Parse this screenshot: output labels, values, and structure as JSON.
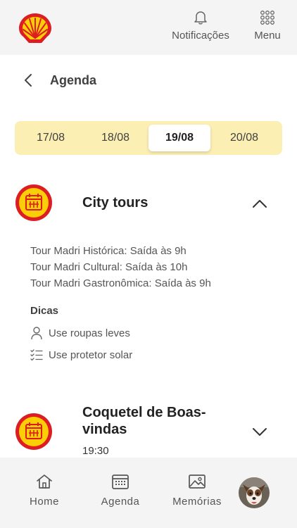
{
  "header": {
    "logo_icon": "shell-logo-icon",
    "notifications_label": "Notificações",
    "menu_label": "Menu"
  },
  "page": {
    "title": "Agenda"
  },
  "dates": {
    "items": [
      "17/08",
      "18/08",
      "19/08",
      "20/08"
    ],
    "selected": "19/08"
  },
  "events": [
    {
      "title": "City tours",
      "expanded": true,
      "details": [
        "Tour Madri Histórica: Saída às 9h",
        "Tour Madri Cultural: Saída às 10h",
        "Tour Madri Gastronômica: Saída às 9h"
      ],
      "tips_title": "Dicas",
      "tips": [
        {
          "icon": "person-icon",
          "text": "Use roupas leves"
        },
        {
          "icon": "checklist-icon",
          "text": "Use protetor solar"
        }
      ]
    },
    {
      "title_line1": "Coquetel de Boas-",
      "title_line2": "vindas",
      "time": "19:30",
      "expanded": false
    }
  ],
  "bottom_nav": {
    "home": "Home",
    "agenda": "Agenda",
    "memories": "Memórias"
  },
  "colors": {
    "shell_yellow": "#fbce07",
    "shell_red": "#dd1d21",
    "date_bar_bg": "#fcefb4",
    "surface": "#f4f4f4"
  }
}
